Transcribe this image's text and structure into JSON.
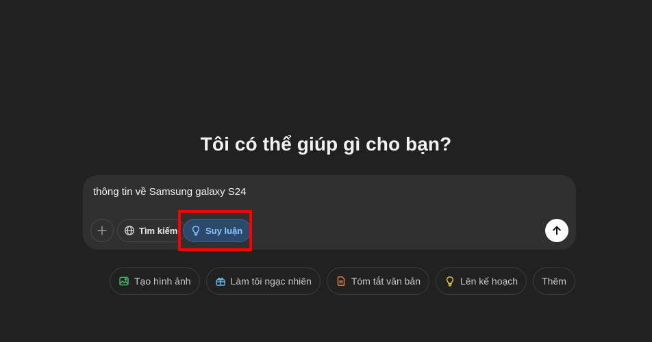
{
  "headline": "Tôi có thể giúp gì cho bạn?",
  "composer": {
    "input_text": "thông tin về Samsung galaxy S24",
    "tools": {
      "add_icon": "plus-icon",
      "search_label": "Tìm kiếm",
      "search_icon": "globe-icon",
      "reason_label": "Suy luận",
      "reason_icon": "lightbulb-icon",
      "reason_active": true
    },
    "send_icon": "arrow-up-icon"
  },
  "suggestions": [
    {
      "label": "Tạo hình ảnh",
      "icon": "image-icon",
      "color": "#4fbf6a"
    },
    {
      "label": "Làm tôi ngạc nhiên",
      "icon": "gift-icon",
      "color": "#6ab8e6"
    },
    {
      "label": "Tóm tắt văn bản",
      "icon": "document-icon",
      "color": "#e8874a"
    },
    {
      "label": "Lên kế hoạch",
      "icon": "lightbulb-icon",
      "color": "#e6c94a"
    },
    {
      "label": "Thêm",
      "icon": "",
      "color": ""
    }
  ],
  "colors": {
    "background": "#212121",
    "composer": "#303030",
    "reason_active_bg": "#2b4a6b",
    "reason_active_text": "#8cc4ff",
    "annotation": "#ff0000"
  }
}
